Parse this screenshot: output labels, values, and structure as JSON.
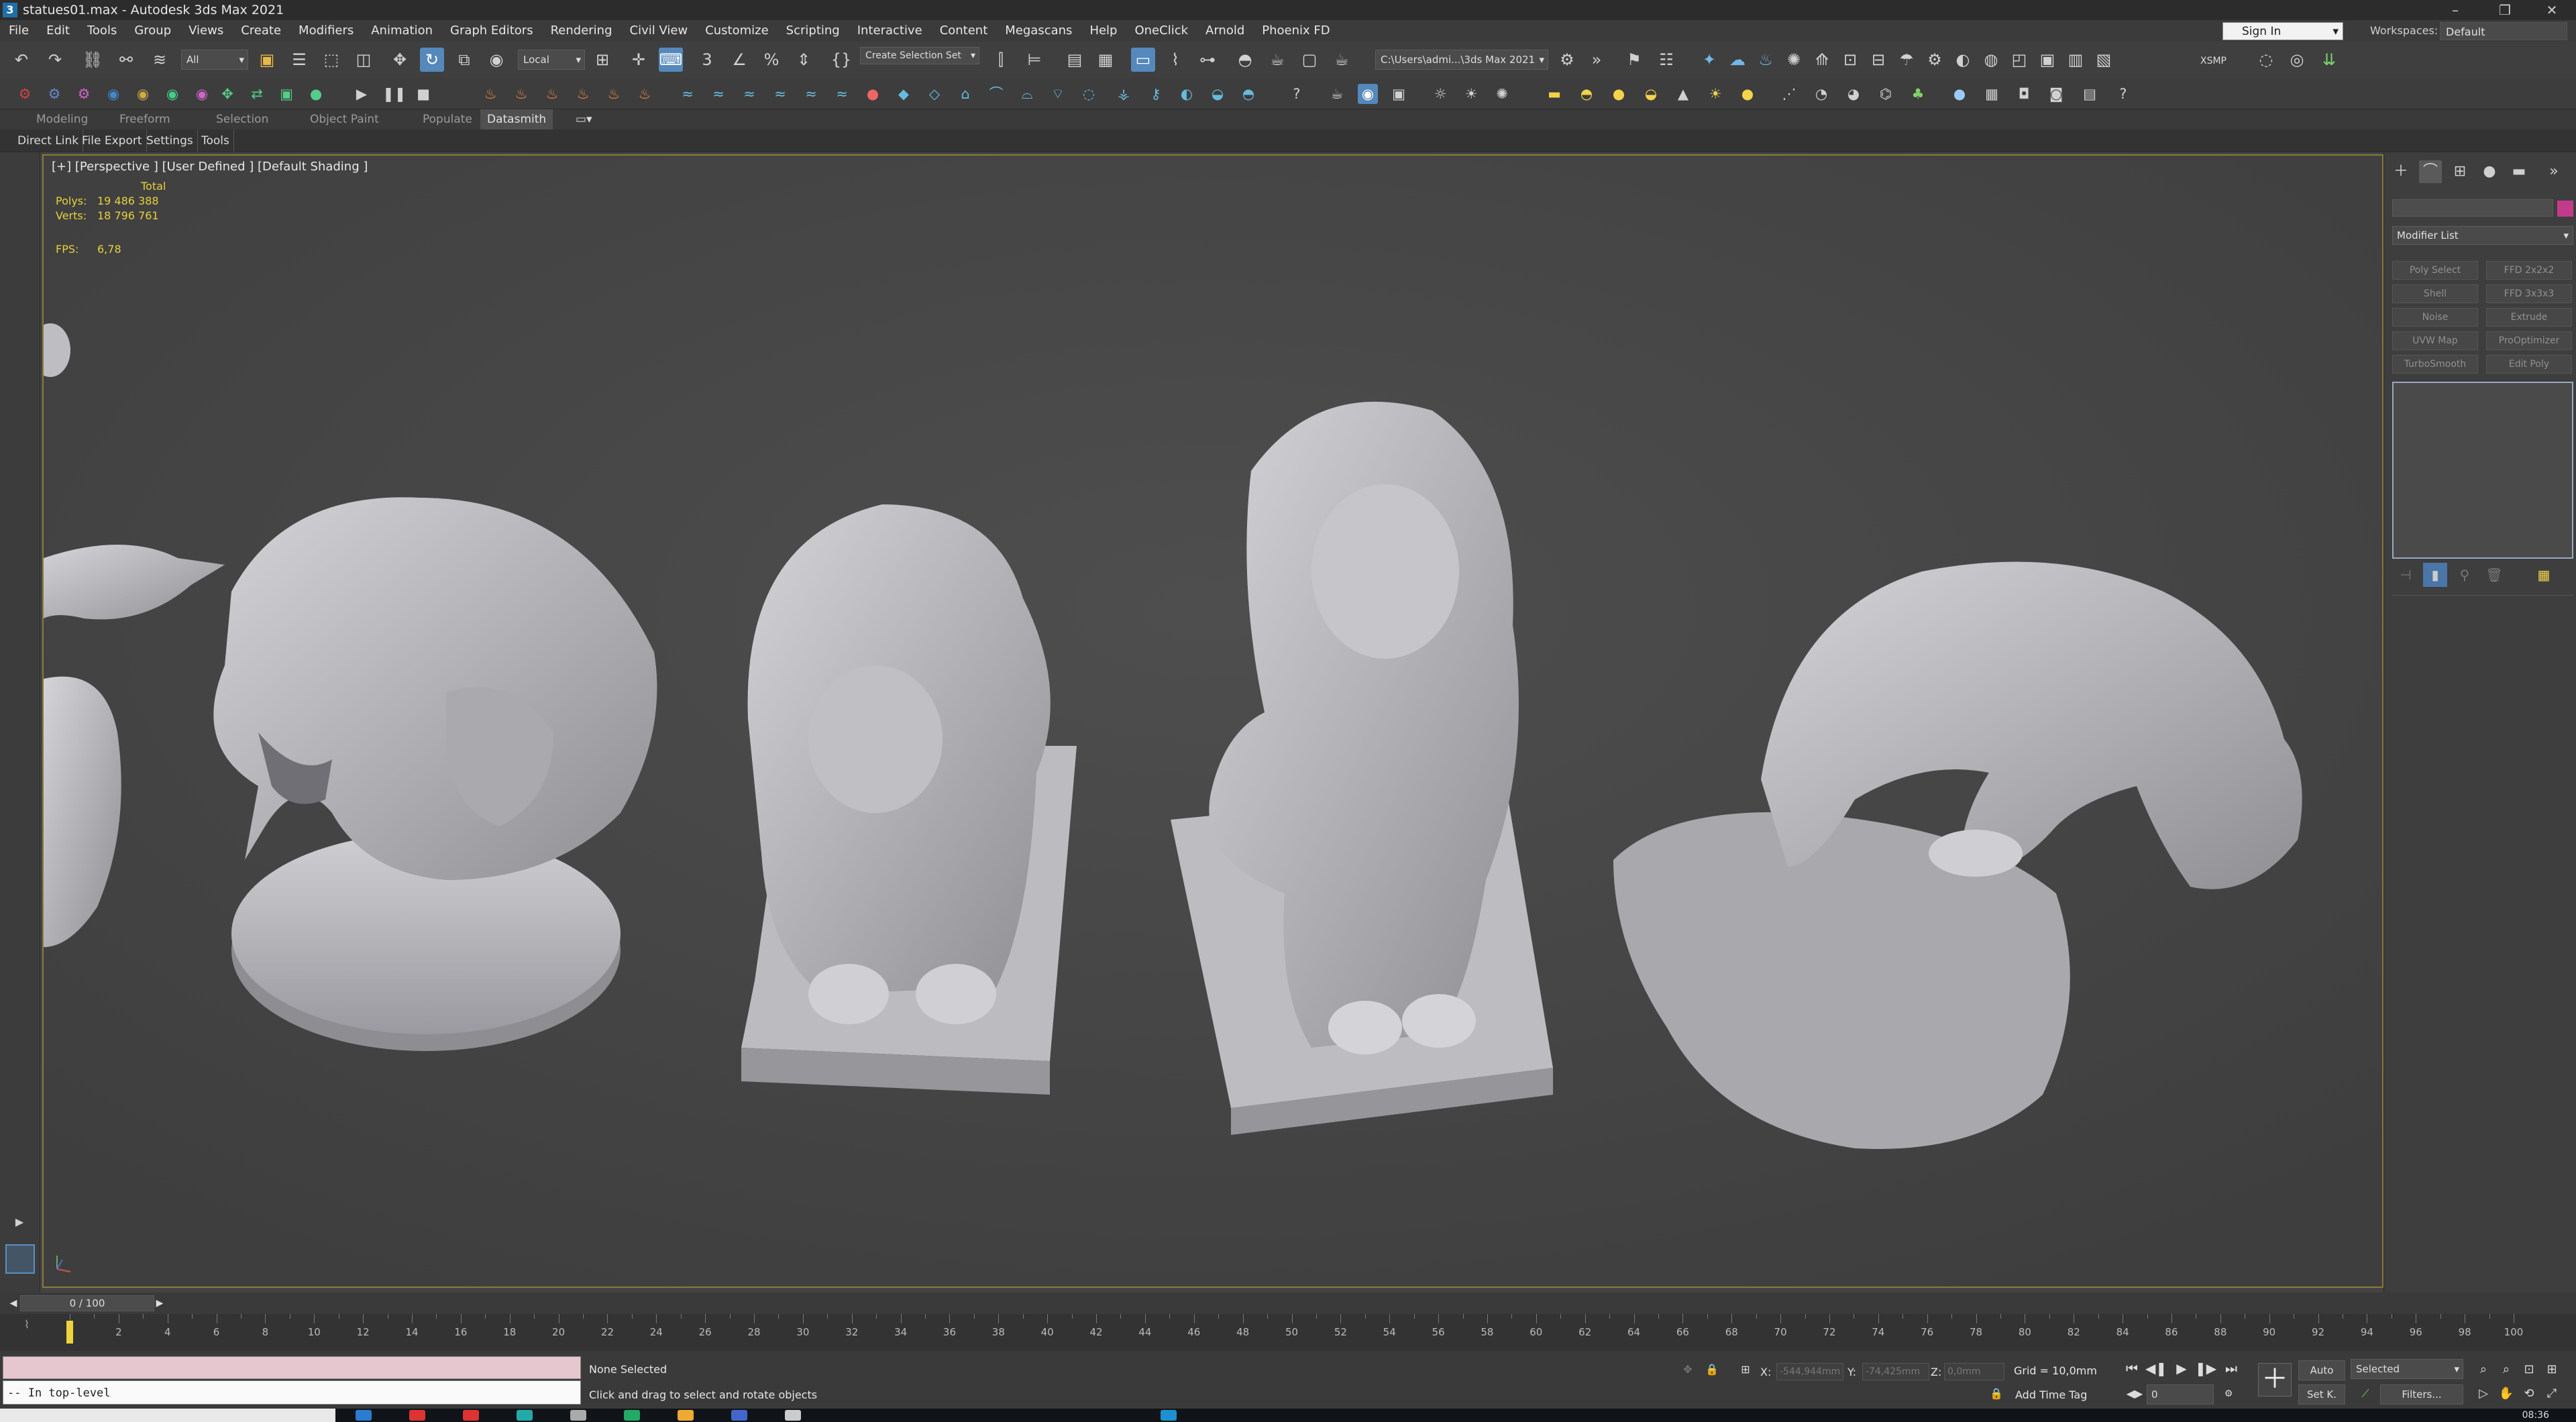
{
  "window": {
    "title": "statues01.max - Autodesk 3ds Max 2021"
  },
  "menu": [
    "File",
    "Edit",
    "Tools",
    "Group",
    "Views",
    "Create",
    "Modifiers",
    "Animation",
    "Graph Editors",
    "Rendering",
    "Civil View",
    "Customize",
    "Scripting",
    "Interactive",
    "Content",
    "Megascans",
    "Help",
    "OneClick",
    "Arnold",
    "Phoenix FD"
  ],
  "account": {
    "sign_in": "Sign In",
    "workspaces_label": "Workspaces:",
    "workspace": "Default"
  },
  "toolbar": {
    "filter": "All",
    "coord_system": "Local",
    "selection_set": "Create Selection Set",
    "project_path": "C:\\Users\\admi...\\3ds Max 2021",
    "xsmp": "XSMP"
  },
  "ribbon": {
    "tabs": [
      "Modeling",
      "Freeform",
      "Selection",
      "Object Paint",
      "Populate",
      "Datasmith"
    ],
    "active": "Datasmith"
  },
  "subtabs": [
    "Direct Link",
    "File Export",
    "Settings",
    "Tools"
  ],
  "viewport": {
    "label": "[+] [Perspective ] [User Defined ] [Default Shading ]",
    "stats_total": "Total",
    "polys_label": "Polys:",
    "polys": "19 486 388",
    "verts_label": "Verts:",
    "verts": "18 796 761",
    "fps_label": "FPS:",
    "fps": "6,78"
  },
  "command_panel": {
    "modifier_list": "Modifier List",
    "modifiers": [
      "Poly Select",
      "FFD 2x2x2",
      "Shell",
      "FFD 3x3x3",
      "Noise",
      "Extrude",
      "UVW Map",
      "ProOptimizer",
      "TurboSmooth",
      "Edit Poly"
    ]
  },
  "timeline": {
    "frame_display": "0 / 100",
    "current_frame": 0,
    "max_frame": 100,
    "ticks": [
      0,
      2,
      4,
      6,
      8,
      10,
      12,
      14,
      16,
      18,
      20,
      22,
      24,
      26,
      28,
      30,
      32,
      34,
      36,
      38,
      40,
      42,
      44,
      46,
      48,
      50,
      52,
      54,
      56,
      58,
      60,
      62,
      64,
      66,
      68,
      70,
      72,
      74,
      76,
      78,
      80,
      82,
      84,
      86,
      88,
      90,
      92,
      94,
      96,
      98,
      100
    ]
  },
  "status": {
    "listener_text": "-- In top-level",
    "selection": "None Selected",
    "prompt": "Click and drag to select and rotate objects",
    "x_label": "X:",
    "x": "-544,944mm",
    "y_label": "Y:",
    "y": "-74,425mm",
    "z_label": "Z:",
    "z": "0,0mm",
    "grid": "Grid = 10,0mm",
    "add_time_tag": "Add Time Tag",
    "frame_field": "0",
    "auto": "Auto",
    "set_key": "Set K.",
    "key_filter": "Selected",
    "filters": "Filters..."
  },
  "taskbar": {
    "clock": "08:36"
  }
}
